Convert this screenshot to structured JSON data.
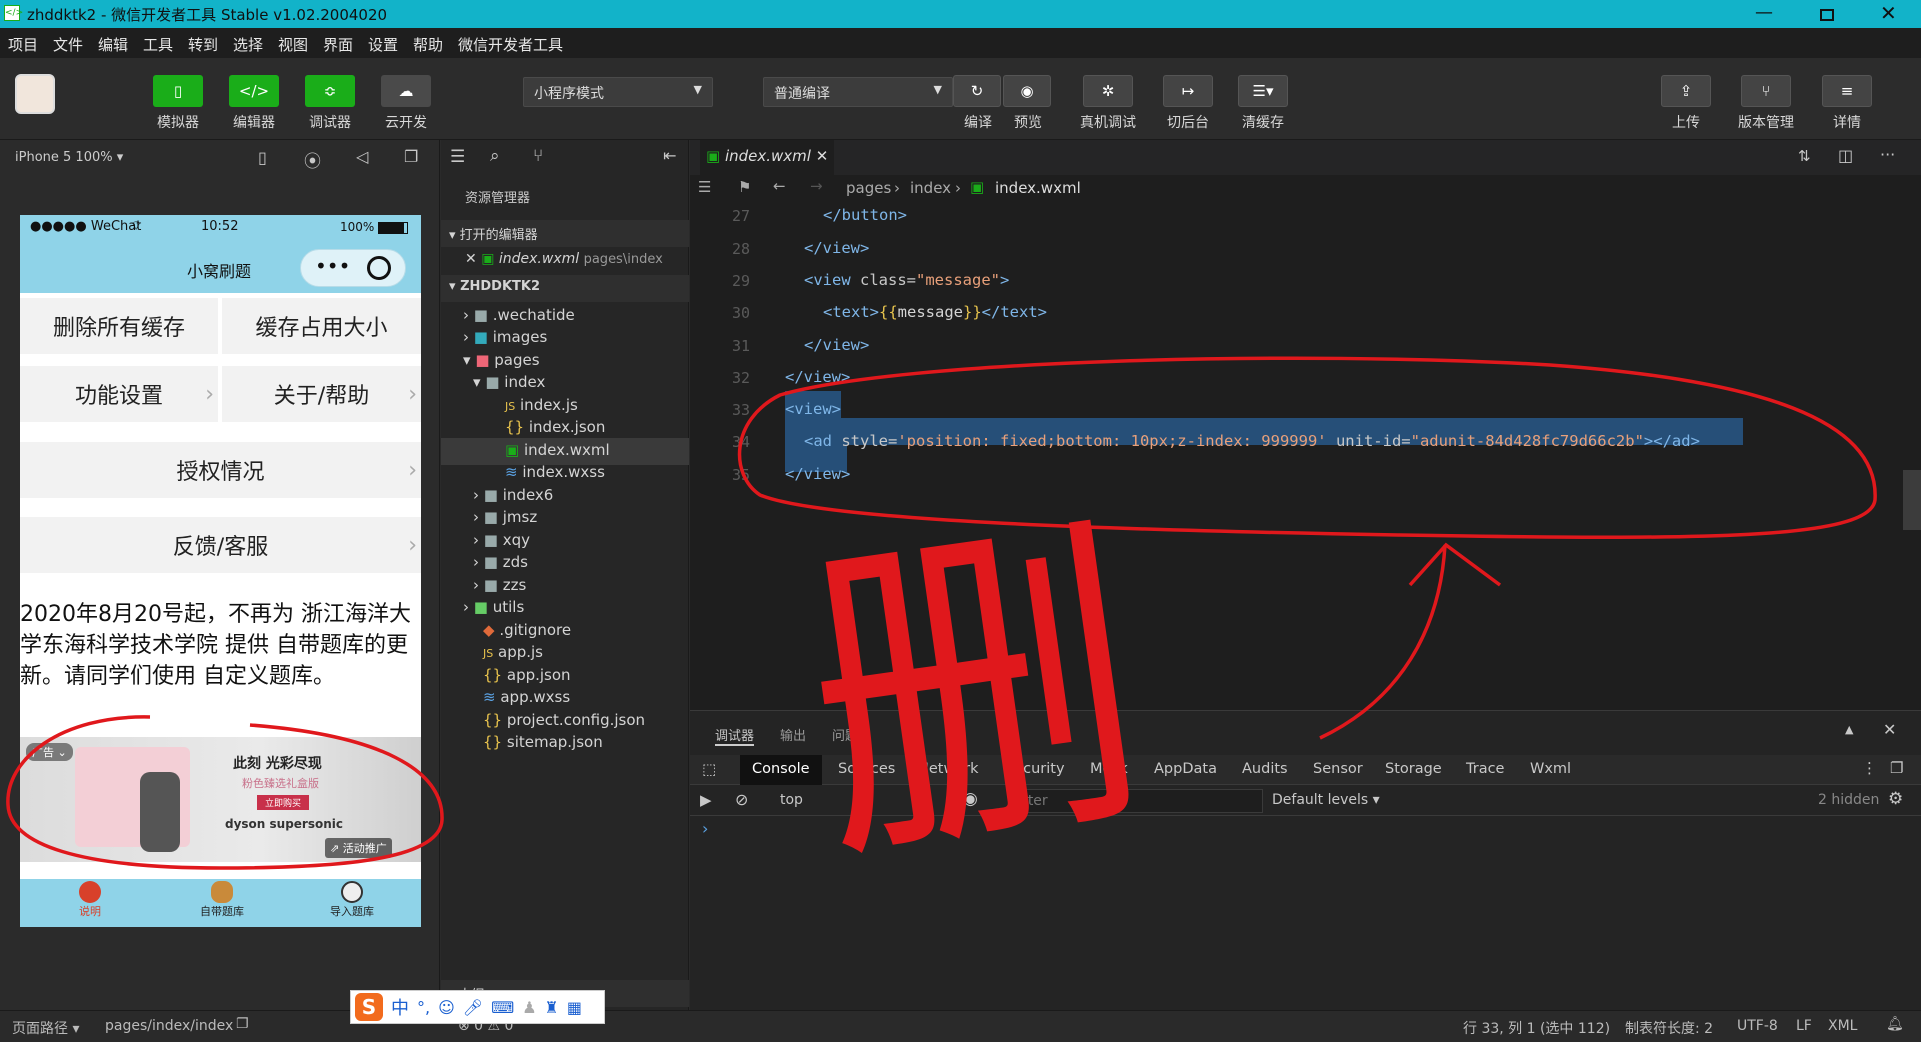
{
  "titlebar": {
    "title": "zhddktk2 - 微信开发者工具 Stable v1.02.2004020"
  },
  "menu": [
    "项目",
    "文件",
    "编辑",
    "工具",
    "转到",
    "选择",
    "视图",
    "界面",
    "设置",
    "帮助",
    "微信开发者工具"
  ],
  "toolbar": {
    "simulator": "模拟器",
    "editor": "编辑器",
    "debugger": "调试器",
    "cloud": "云开发",
    "mode_value": "小程序模式",
    "compile_value": "普通编译",
    "compile": "编译",
    "preview": "预览",
    "realdebug": "真机调试",
    "background": "切后台",
    "clearcache": "清缓存",
    "upload": "上传",
    "version": "版本管理",
    "details": "详情"
  },
  "sim": {
    "device": "iPhone 5 100% ▾",
    "status_carrier": "●●●●● WeChat",
    "status_time": "10:52",
    "status_battery": "100%",
    "nav_title": "小窝刷题",
    "btn_clear_cache": "删除所有缓存",
    "btn_cache_size": "缓存占用大小",
    "btn_settings": "功能设置",
    "btn_about": "关于/帮助",
    "btn_auth": "授权情况",
    "btn_feedback": "反馈/客服",
    "notice": "2020年8月20号起，不再为 浙江海洋大学东海科学技术学院 提供 自带题库的更新。请同学们使用 自定义题库。",
    "ad_tag": "广告",
    "ad_headline": "此刻 光彩尽现",
    "ad_sub": "粉色臻选礼盒版",
    "ad_cta": "立即购买",
    "ad_brand": "dyson supersonic",
    "ad_promo": "活动推广",
    "tab_intro": "说明",
    "tab_builtin": "自带题库",
    "tab_import": "导入题库"
  },
  "explorer": {
    "title": "资源管理器",
    "open_editors": "打开的编辑器",
    "open_file": "index.wxml",
    "open_file_path": "pages\\index",
    "project": "ZHDDKTK2",
    "items": [
      ".wechatide",
      "images",
      "pages",
      "index",
      "index.js",
      "index.json",
      "index.wxml",
      "index.wxss",
      "index6",
      "jmsz",
      "xqy",
      "zds",
      "zzs",
      "utils",
      ".gitignore",
      "app.js",
      "app.json",
      "app.wxss",
      "project.config.json",
      "sitemap.json"
    ],
    "outline": "大纲"
  },
  "editor": {
    "tab": "index.wxml",
    "crumb_pages": "pages",
    "crumb_index": "index",
    "crumb_file": "index.wxml",
    "line_numbers": [
      "27",
      "28",
      "29",
      "30",
      "31",
      "32",
      "33",
      "34",
      "35"
    ]
  },
  "devtools": {
    "top_tabs": [
      "调试器",
      "输出",
      "问题"
    ],
    "tabs": [
      "Console",
      "Sources",
      "Network",
      "Security",
      "Mock",
      "AppData",
      "Audits",
      "Sensor",
      "Storage",
      "Trace",
      "Wxml"
    ],
    "context": "top",
    "filter_placeholder": "Filter",
    "levels": "Default levels ▾",
    "hidden": "2 hidden",
    "prompt": "›"
  },
  "statusbar": {
    "path_label": "页面路径 ▾",
    "path": "pages/index/index",
    "errors": "⊗ 0 ⚠ 0",
    "cursor": "行 33, 列 1 (选中 112)",
    "tab_size": "制表符长度: 2",
    "encoding": "UTF-8",
    "eol": "LF",
    "lang": "XML"
  },
  "ime": {
    "zh": "中"
  },
  "annotation": {
    "char": "删"
  },
  "colors": {
    "titlebar": "#12b3c9",
    "green": "#1aad19",
    "annotation": "#e0181c",
    "selection": "#264f78"
  }
}
